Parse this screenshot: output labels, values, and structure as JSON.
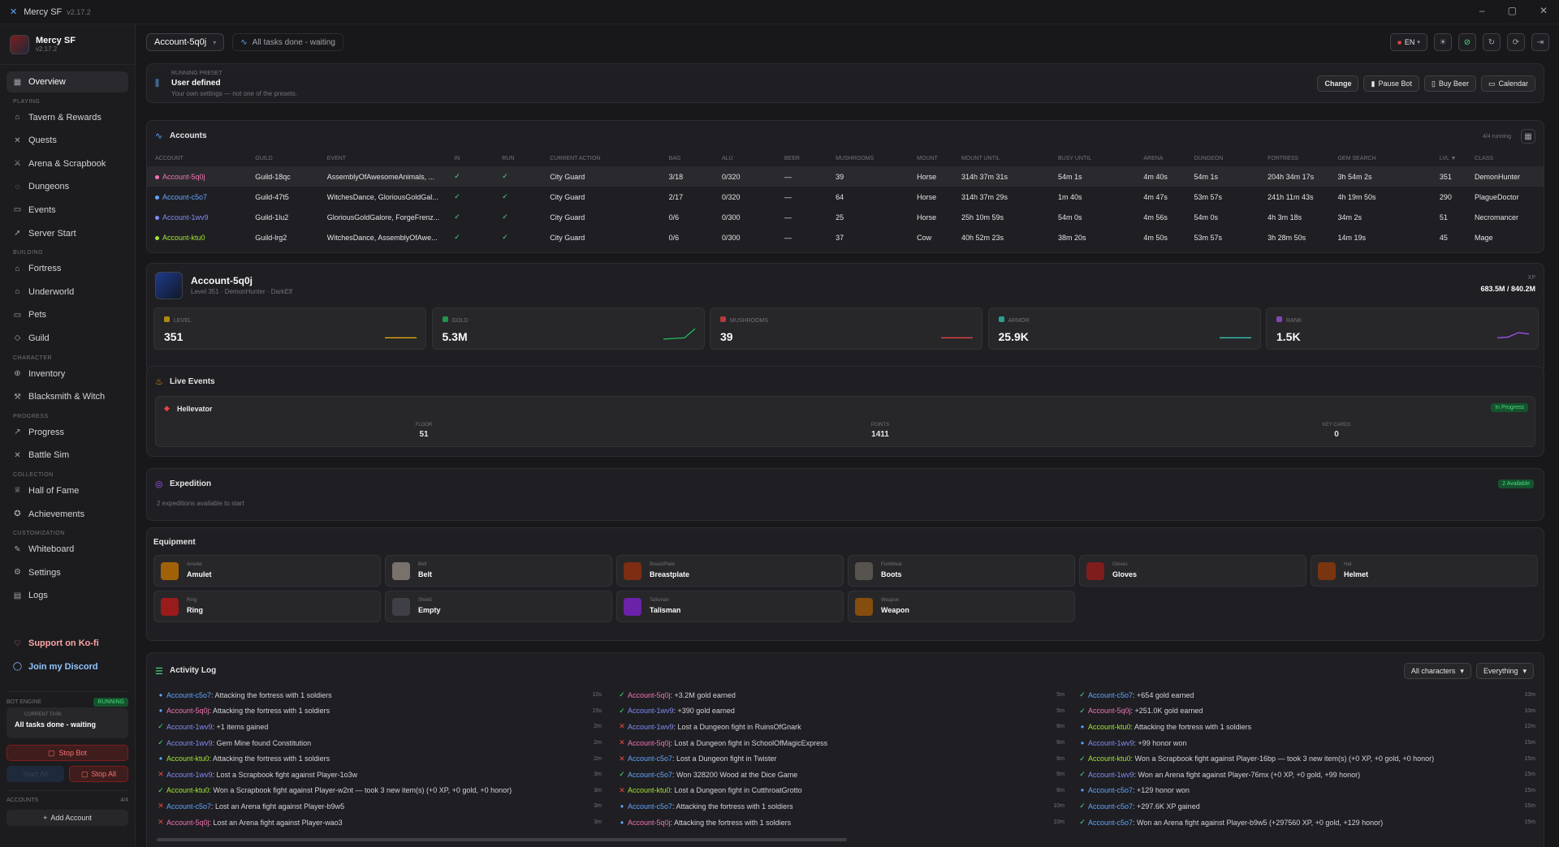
{
  "window": {
    "title": "Mercy SF",
    "version": "v2.17.2"
  },
  "sidebar": {
    "app_name": "Mercy SF",
    "app_version": "v2.17.2",
    "overview": "Overview",
    "sections": [
      {
        "label": "PLAYING",
        "items": [
          "Tavern & Rewards",
          "Quests",
          "Arena & Scrapbook",
          "Dungeons",
          "Events",
          "Server Start"
        ]
      },
      {
        "label": "BUILDING",
        "items": [
          "Fortress",
          "Underworld",
          "Pets",
          "Guild"
        ]
      },
      {
        "label": "CHARACTER",
        "items": [
          "Inventory",
          "Blacksmith & Witch"
        ]
      },
      {
        "label": "PROGRESS",
        "items": [
          "Progress",
          "Battle Sim"
        ]
      },
      {
        "label": "COLLECTION",
        "items": [
          "Hall of Fame",
          "Achievements"
        ]
      },
      {
        "label": "CUSTOMIZATION",
        "items": [
          "Whiteboard",
          "Settings",
          "Logs"
        ]
      }
    ],
    "support": "Support on Ko-fi",
    "discord": "Join my Discord",
    "engine": {
      "label": "BOT ENGINE",
      "status": "RUNNING",
      "task_label": "CURRENT TASK",
      "task": "All tasks done - waiting",
      "stop_bot": "Stop Bot",
      "start_all": "Start All",
      "stop_all": "Stop All",
      "accounts_label": "ACCOUNTS",
      "accounts_count": "4/4",
      "add_account": "Add Account"
    }
  },
  "topbar": {
    "account": "Account-5q0j",
    "status": "All tasks done - waiting",
    "lang": "EN"
  },
  "preset": {
    "label": "RUNNING PRESET",
    "name": "User defined",
    "desc": "Your own settings — not one of the presets.",
    "change": "Change",
    "pause": "Pause Bot",
    "beer": "Buy Beer",
    "calendar": "Calendar"
  },
  "accounts": {
    "title": "Accounts",
    "running": "4/4 running",
    "columns": [
      "ACCOUNT",
      "GUILD",
      "EVENT",
      "IN",
      "RUN",
      "CURRENT ACTION",
      "BAG",
      "ALU",
      "BEER",
      "MUSHROOMS",
      "MOUNT",
      "MOUNT UNTIL",
      "BUSY UNTIL",
      "ARENA",
      "DUNGEON",
      "FORTRESS",
      "GEM SEARCH",
      "LVL ▼",
      "CLASS"
    ],
    "rows": [
      {
        "color": "#f472b6",
        "cells": [
          "Account-5q0j",
          "Guild-18qc",
          "AssemblyOfAwesomeAnimals, ...",
          "✓",
          "✓",
          "City Guard",
          "3/18",
          "0/320",
          "—",
          "39",
          "Horse",
          "314h 37m 31s",
          "54m 1s",
          "4m 40s",
          "54m 1s",
          "204h 34m 17s",
          "3h 54m 2s",
          "351",
          "DemonHunter"
        ]
      },
      {
        "color": "#60a5fa",
        "cells": [
          "Account-c5o7",
          "Guild-47t5",
          "WitchesDance, GloriousGoldGal...",
          "✓",
          "✓",
          "City Guard",
          "2/17",
          "0/320",
          "—",
          "64",
          "Horse",
          "314h 37m 29s",
          "1m 40s",
          "4m 47s",
          "53m 57s",
          "241h 11m 43s",
          "4h 19m 50s",
          "290",
          "PlagueDoctor"
        ]
      },
      {
        "color": "#818cf8",
        "cells": [
          "Account-1wv9",
          "Guild-1lu2",
          "GloriousGoldGalore, ForgeFrenz...",
          "✓",
          "✓",
          "City Guard",
          "0/6",
          "0/300",
          "—",
          "25",
          "Horse",
          "25h 10m 59s",
          "54m 0s",
          "4m 56s",
          "54m 0s",
          "4h 3m 18s",
          "34m 2s",
          "51",
          "Necromancer"
        ]
      },
      {
        "color": "#a3e635",
        "cells": [
          "Account-ktu0",
          "Guild-lrg2",
          "WitchesDance, AssemblyOfAwe...",
          "✓",
          "✓",
          "City Guard",
          "0/6",
          "0/300",
          "—",
          "37",
          "Cow",
          "40h 52m 23s",
          "38m 20s",
          "4m 50s",
          "53m 57s",
          "3h 28m 50s",
          "14m 19s",
          "45",
          "Mage"
        ]
      }
    ]
  },
  "character": {
    "name": "Account-5q0j",
    "sub": "Level 351 · DemonHunter · DarkElf",
    "xp_label": "XP",
    "xp": "683.5M / 840.2M",
    "stats": [
      {
        "label": "LEVEL",
        "value": "351",
        "color": "#eab308"
      },
      {
        "label": "GOLD",
        "value": "5.3M",
        "color": "#22c55e"
      },
      {
        "label": "MUSHROOMS",
        "value": "39",
        "color": "#ef4444"
      },
      {
        "label": "ARMOR",
        "value": "25.9K",
        "color": "#2dd4bf"
      },
      {
        "label": "RANK",
        "value": "1.5K",
        "color": "#a855f7"
      }
    ]
  },
  "live_events": {
    "title": "Live Events",
    "event": "Hellevator",
    "status": "In Progress",
    "fields": [
      {
        "label": "FLOOR",
        "value": "51"
      },
      {
        "label": "POINTS",
        "value": "1411"
      },
      {
        "label": "KEY CARDS",
        "value": "0"
      }
    ]
  },
  "expedition": {
    "title": "Expedition",
    "desc": "2 expeditions available to start",
    "badge": "2 Available"
  },
  "equipment": {
    "title": "Equipment",
    "items": [
      {
        "slot": "Amulet",
        "name": "Amulet"
      },
      {
        "slot": "Belt",
        "name": "Belt"
      },
      {
        "slot": "BreastPlate",
        "name": "Breastplate"
      },
      {
        "slot": "FootWear",
        "name": "Boots"
      },
      {
        "slot": "Gloves",
        "name": "Gloves"
      },
      {
        "slot": "Hat",
        "name": "Helmet"
      },
      {
        "slot": "Ring",
        "name": "Ring"
      },
      {
        "slot": "Shield",
        "name": "Empty"
      },
      {
        "slot": "Talisman",
        "name": "Talisman"
      },
      {
        "slot": "Weapon",
        "name": "Weapon"
      }
    ]
  },
  "activity": {
    "title": "Activity Log",
    "filter1": "All characters",
    "filter2": "Everything",
    "columns": [
      [
        {
          "mark": "dot",
          "acc": "Account-c5o7",
          "color": "#60a5fa",
          "text": ": Attacking the fortress with 1 soldiers",
          "time": "10s"
        },
        {
          "mark": "dot",
          "acc": "Account-5q0j",
          "color": "#f472b6",
          "text": ": Attacking the fortress with 1 soldiers",
          "time": "15s"
        },
        {
          "mark": "ok",
          "acc": "Account-1wv9",
          "color": "#818cf8",
          "text": ": +1 items gained",
          "time": "2m"
        },
        {
          "mark": "ok",
          "acc": "Account-1wv9",
          "color": "#818cf8",
          "text": ": Gem Mine found Constitution",
          "time": "2m"
        },
        {
          "mark": "dot",
          "acc": "Account-ktu0",
          "color": "#a3e635",
          "text": ": Attacking the fortress with 1 soldiers",
          "time": "2m"
        },
        {
          "mark": "x",
          "acc": "Account-1wv9",
          "color": "#818cf8",
          "text": ": Lost a Scrapbook fight against Player-1o3w",
          "time": "3m"
        },
        {
          "mark": "ok",
          "acc": "Account-ktu0",
          "color": "#a3e635",
          "text": ": Won a Scrapbook fight against Player-w2nt — took 3 new item(s) (+0 XP, +0 gold, +0 honor)",
          "time": "3m"
        },
        {
          "mark": "x",
          "acc": "Account-c5o7",
          "color": "#60a5fa",
          "text": ": Lost an Arena fight against Player-b9w5",
          "time": "3m"
        },
        {
          "mark": "x",
          "acc": "Account-5q0j",
          "color": "#f472b6",
          "text": ": Lost an Arena fight against Player-wao3",
          "time": "3m"
        }
      ],
      [
        {
          "mark": "ok",
          "acc": "Account-5q0j",
          "color": "#f472b6",
          "text": ": +3.2M gold earned",
          "time": "5m"
        },
        {
          "mark": "ok",
          "acc": "Account-1wv9",
          "color": "#818cf8",
          "text": ": +390 gold earned",
          "time": "5m"
        },
        {
          "mark": "x",
          "acc": "Account-1wv9",
          "color": "#818cf8",
          "text": ": Lost a Dungeon fight in RuinsOfGnark",
          "time": "6m"
        },
        {
          "mark": "x",
          "acc": "Account-5q0j",
          "color": "#f472b6",
          "text": ": Lost a Dungeon fight in SchoolOfMagicExpress",
          "time": "6m"
        },
        {
          "mark": "x",
          "acc": "Account-c5o7",
          "color": "#60a5fa",
          "text": ": Lost a Dungeon fight in Twister",
          "time": "6m"
        },
        {
          "mark": "ok",
          "acc": "Account-c5o7",
          "color": "#60a5fa",
          "text": ": Won 328200 Wood at the Dice Game",
          "time": "6m"
        },
        {
          "mark": "x",
          "acc": "Account-ktu0",
          "color": "#a3e635",
          "text": ": Lost a Dungeon fight in CutthroatGrotto",
          "time": "6m"
        },
        {
          "mark": "dot",
          "acc": "Account-c5o7",
          "color": "#60a5fa",
          "text": ": Attacking the fortress with 1 soldiers",
          "time": "10m"
        },
        {
          "mark": "dot",
          "acc": "Account-5q0j",
          "color": "#f472b6",
          "text": ": Attacking the fortress with 1 soldiers",
          "time": "10m"
        }
      ],
      [
        {
          "mark": "ok",
          "acc": "Account-c5o7",
          "color": "#60a5fa",
          "text": ": +654 gold earned",
          "time": "10m"
        },
        {
          "mark": "ok",
          "acc": "Account-5q0j",
          "color": "#f472b6",
          "text": ": +251.0K gold earned",
          "time": "10m"
        },
        {
          "mark": "dot",
          "acc": "Account-ktu0",
          "color": "#a3e635",
          "text": ": Attacking the fortress with 1 soldiers",
          "time": "12m"
        },
        {
          "mark": "dot",
          "acc": "Account-1wv9",
          "color": "#818cf8",
          "text": ": +99 honor won",
          "time": "15m"
        },
        {
          "mark": "ok",
          "acc": "Account-ktu0",
          "color": "#a3e635",
          "text": ": Won a Scrapbook fight against Player-16bp — took 3 new item(s) (+0 XP, +0 gold, +0 honor)",
          "time": "15m"
        },
        {
          "mark": "ok",
          "acc": "Account-1wv9",
          "color": "#818cf8",
          "text": ": Won an Arena fight against Player-76mx (+0 XP, +0 gold, +99 honor)",
          "time": "15m"
        },
        {
          "mark": "dot",
          "acc": "Account-c5o7",
          "color": "#60a5fa",
          "text": ": +129 honor won",
          "time": "15m"
        },
        {
          "mark": "ok",
          "acc": "Account-c5o7",
          "color": "#60a5fa",
          "text": ": +297.6K XP gained",
          "time": "15m"
        },
        {
          "mark": "ok",
          "acc": "Account-c5o7",
          "color": "#60a5fa",
          "text": ": Won an Arena fight against Player-b9w5 (+297560 XP, +0 gold, +129 honor)",
          "time": "15m"
        }
      ]
    ]
  }
}
